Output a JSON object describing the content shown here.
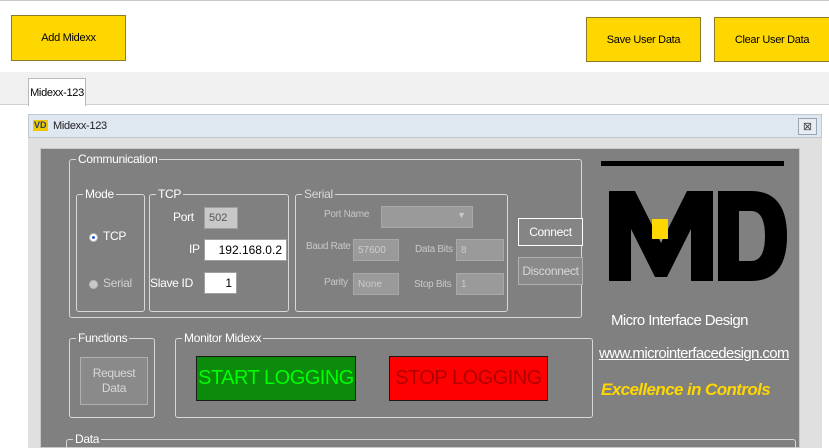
{
  "toolbar": {
    "add_label": "Add Midexx",
    "save_label": "Save User Data",
    "clear_label": "Clear User Data"
  },
  "tabs": [
    {
      "label": "Midexx-123"
    }
  ],
  "child_window": {
    "icon_text": "VD",
    "title": "Midexx-123",
    "close_glyph": "⊠"
  },
  "communication": {
    "label": "Communication",
    "mode": {
      "label": "Mode",
      "tcp_label": "TCP",
      "serial_label": "Serial",
      "selected": "TCP"
    },
    "tcp": {
      "label": "TCP",
      "port_label": "Port",
      "port_value": "502",
      "ip_label": "IP",
      "ip_value": "192.168.0.2",
      "slave_label": "Slave ID",
      "slave_value": "1"
    },
    "serial": {
      "label": "Serial",
      "port_name_label": "Port Name",
      "port_name_value": "",
      "baud_label": "Baud Rate",
      "baud_value": "57600",
      "data_bits_label": "Data Bits",
      "data_bits_value": "8",
      "parity_label": "Parity",
      "parity_value": "None",
      "stop_bits_label": "Stop Bits",
      "stop_bits_value": "1"
    },
    "connect_label": "Connect",
    "disconnect_label": "Disconnect"
  },
  "functions": {
    "label": "Functions",
    "request_line1": "Request",
    "request_line2": "Data"
  },
  "monitor": {
    "label": "Monitor Midexx",
    "start_label": "START LOGGING",
    "stop_label": "STOP LOGGING"
  },
  "branding": {
    "name": "Micro Interface Design",
    "url": "www.microinterfacedesign.com",
    "tagline": "Excellence in Controls"
  },
  "data_section": {
    "label": "Data"
  },
  "colors": {
    "toolbar_button": "#ffd700",
    "panel_bg": "#808080",
    "start_bg": "#0b8a0b",
    "stop_bg": "#ff0000",
    "tagline": "#ffd700"
  }
}
